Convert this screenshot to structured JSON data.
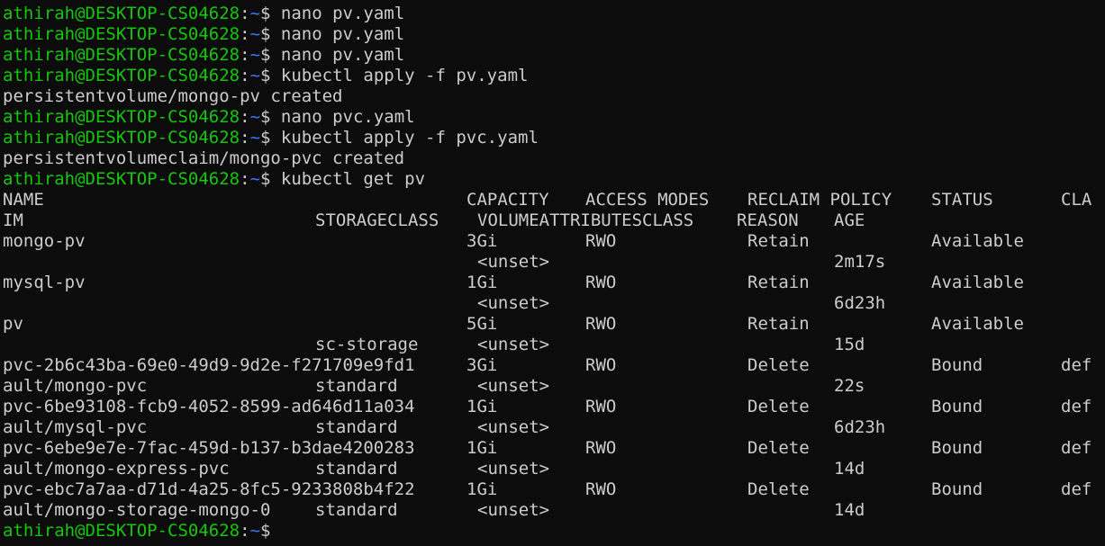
{
  "prompt": {
    "user": "athirah@DESKTOP-CS04628",
    "sep": ":",
    "path": "~",
    "symbol": "$"
  },
  "commands": [
    {
      "type": "cmd",
      "text": " nano pv.yaml"
    },
    {
      "type": "cmd",
      "text": " nano pv.yaml"
    },
    {
      "type": "cmd",
      "text": " nano pv.yaml"
    },
    {
      "type": "cmd",
      "text": " kubectl apply -f pv.yaml"
    },
    {
      "type": "out",
      "text": "persistentvolume/mongo-pv created"
    },
    {
      "type": "cmd",
      "text": " nano pvc.yaml"
    },
    {
      "type": "cmd",
      "text": " kubectl apply -f pvc.yaml"
    },
    {
      "type": "out",
      "text": "persistentvolumeclaim/mongo-pvc created"
    },
    {
      "type": "cmd",
      "text": " kubectl get pv"
    }
  ],
  "table": {
    "header1": {
      "name": "NAME",
      "capacity": "CAPACITY",
      "access": "ACCESS MODES",
      "reclaim": "RECLAIM POLICY",
      "status": "STATUS",
      "claim": "CLA"
    },
    "header2": {
      "name": "IM",
      "storageclass": "STORAGECLASS",
      "vac": "VOLUMEATTRIBUTESCLASS",
      "reason": "REASON",
      "age": "AGE"
    },
    "rows": [
      {
        "line1": {
          "name": "mongo-pv",
          "capacity": "3Gi",
          "access": "RWO",
          "reclaim": "Retain",
          "status": "Available",
          "claim": ""
        },
        "line2": {
          "name": "",
          "storageclass": "",
          "vac": "<unset>",
          "age": "2m17s"
        }
      },
      {
        "line1": {
          "name": "mysql-pv",
          "capacity": "1Gi",
          "access": "RWO",
          "reclaim": "Retain",
          "status": "Available",
          "claim": ""
        },
        "line2": {
          "name": "",
          "storageclass": "",
          "vac": "<unset>",
          "age": "6d23h"
        }
      },
      {
        "line1": {
          "name": "pv",
          "capacity": "5Gi",
          "access": "RWO",
          "reclaim": "Retain",
          "status": "Available",
          "claim": ""
        },
        "line2": {
          "name": "",
          "storageclass": "sc-storage",
          "vac": "<unset>",
          "age": "15d"
        }
      },
      {
        "line1": {
          "name": "pvc-2b6c43ba-69e0-49d9-9d2e-f271709e9fd1",
          "capacity": "3Gi",
          "access": "RWO",
          "reclaim": "Delete",
          "status": "Bound",
          "claim": "def"
        },
        "line2": {
          "name": "ault/mongo-pvc",
          "storageclass": "standard",
          "vac": "<unset>",
          "age": "22s"
        }
      },
      {
        "line1": {
          "name": "pvc-6be93108-fcb9-4052-8599-ad646d11a034",
          "capacity": "1Gi",
          "access": "RWO",
          "reclaim": "Delete",
          "status": "Bound",
          "claim": "def"
        },
        "line2": {
          "name": "ault/mysql-pvc",
          "storageclass": "standard",
          "vac": "<unset>",
          "age": "6d23h"
        }
      },
      {
        "line1": {
          "name": "pvc-6ebe9e7e-7fac-459d-b137-b3dae4200283",
          "capacity": "1Gi",
          "access": "RWO",
          "reclaim": "Delete",
          "status": "Bound",
          "claim": "def"
        },
        "line2": {
          "name": "ault/mongo-express-pvc",
          "storageclass": "standard",
          "vac": "<unset>",
          "age": "14d"
        }
      },
      {
        "line1": {
          "name": "pvc-ebc7a7aa-d71d-4a25-8fc5-9233808b4f22",
          "capacity": "1Gi",
          "access": "RWO",
          "reclaim": "Delete",
          "status": "Bound",
          "claim": "def"
        },
        "line2": {
          "name": "ault/mongo-storage-mongo-0",
          "storageclass": "standard",
          "vac": "<unset>",
          "age": "14d"
        }
      }
    ]
  },
  "final_prompt": {
    "text": ""
  },
  "colors": {
    "background": "#0c0c0c",
    "text": "#cccccc",
    "user": "#16c60c",
    "path": "#3b78ff"
  }
}
